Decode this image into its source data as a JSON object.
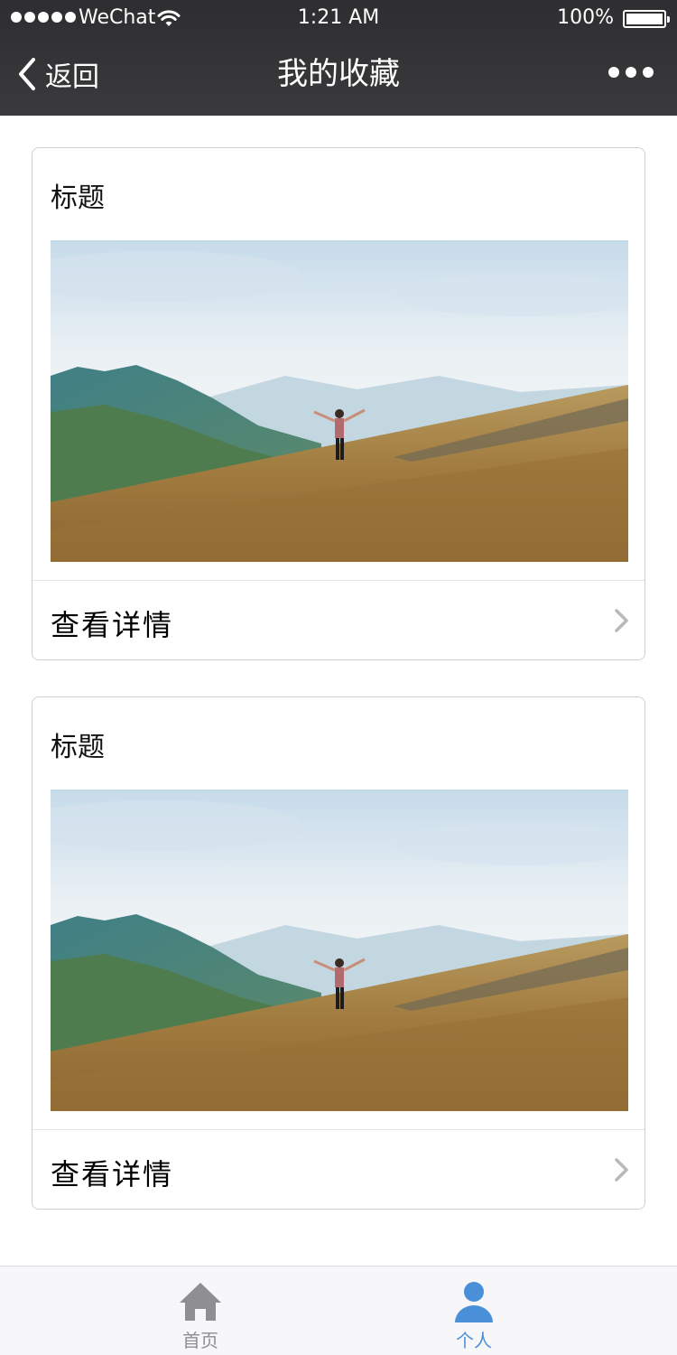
{
  "status_bar": {
    "carrier": "WeChat",
    "time": "1:21 AM",
    "battery": "100%"
  },
  "nav": {
    "back_label": "返回",
    "title": "我的收藏"
  },
  "cards": [
    {
      "title": "标题",
      "link_label": "查看详情"
    },
    {
      "title": "标题",
      "link_label": "查看详情"
    }
  ],
  "tabbar": {
    "items": [
      {
        "label": "首页",
        "icon": "home-icon",
        "active": false
      },
      {
        "label": "个人",
        "icon": "person-icon",
        "active": true
      }
    ],
    "active_color": "#4a90d9",
    "inactive_color": "#8e8e93"
  }
}
